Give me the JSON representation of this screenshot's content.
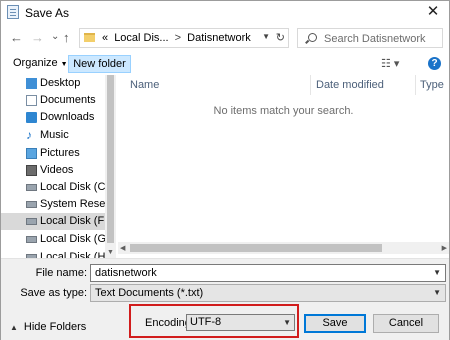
{
  "window": {
    "title": "Save As",
    "close_glyph": "✕"
  },
  "nav": {
    "back_glyph": "←",
    "forward_glyph": "→",
    "recent_glyph": "⌄",
    "up_glyph": "↑",
    "breadcrumb": {
      "overflow": "«",
      "items": [
        "Local Dis...",
        "Datisnetwork"
      ],
      "separator": ">"
    },
    "dropdown_glyph": "▼",
    "refresh_glyph": "↻",
    "search_placeholder": "Search Datisnetwork"
  },
  "toolbar": {
    "organize_label": "Organize",
    "caret": "▼",
    "new_folder_label": "New folder",
    "view_glyph": "☷ ▾",
    "help_glyph": "?"
  },
  "sidebar": {
    "items": [
      {
        "label": "Desktop",
        "icon": "desktop-icon"
      },
      {
        "label": "Documents",
        "icon": "documents-icon"
      },
      {
        "label": "Downloads",
        "icon": "downloads-icon"
      },
      {
        "label": "Music",
        "icon": "music-icon"
      },
      {
        "label": "Pictures",
        "icon": "pictures-icon"
      },
      {
        "label": "Videos",
        "icon": "videos-icon"
      },
      {
        "label": "Local Disk (C:)",
        "icon": "drive-icon"
      },
      {
        "label": "System Reserved",
        "icon": "drive-icon"
      },
      {
        "label": "Local Disk (F:)",
        "icon": "drive-icon",
        "selected": true
      },
      {
        "label": "Local Disk (G:)",
        "icon": "drive-icon"
      },
      {
        "label": "Local Disk (H:)",
        "icon": "drive-icon"
      }
    ]
  },
  "files": {
    "columns": [
      "Name",
      "Date modified",
      "Type"
    ],
    "empty_message": "No items match your search."
  },
  "form": {
    "filename_label": "File name:",
    "filename_value": "datisnetwork",
    "savetype_label": "Save as type:",
    "savetype_value": "Text Documents (*.txt)",
    "encoding_label": "Encoding:",
    "encoding_value": "UTF-8"
  },
  "buttons": {
    "hide_folders": "Hide Folders",
    "save": "Save",
    "cancel": "Cancel"
  },
  "colors": {
    "accent": "#0078d7",
    "highlight_box": "#d11c1c",
    "new_folder_bg": "#cce8ff"
  }
}
